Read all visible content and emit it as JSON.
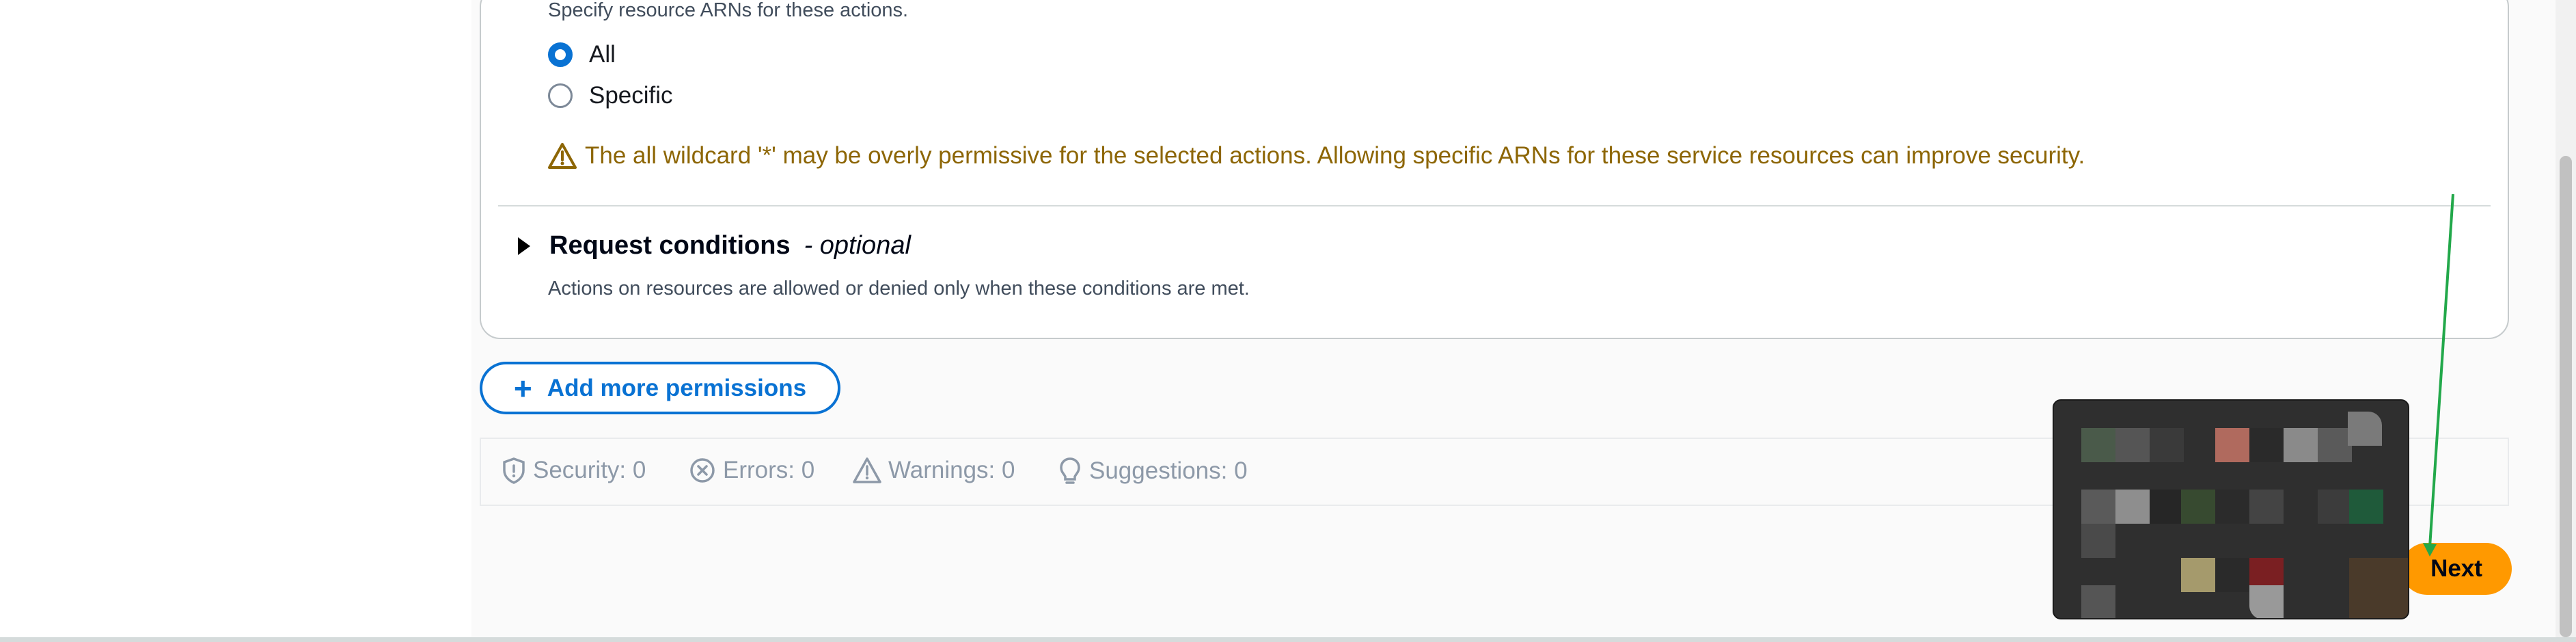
{
  "resources": {
    "description": "Specify resource ARNs for these actions.",
    "options": [
      {
        "label": "All",
        "selected": true
      },
      {
        "label": "Specific",
        "selected": false
      }
    ],
    "warning_text": "The all wildcard '*' may be overly permissive for the selected actions. Allowing specific ARNs for these service resources can improve security."
  },
  "request_conditions": {
    "title": "Request conditions",
    "optional_label": "- optional",
    "description": "Actions on resources are allowed or denied only when these conditions are met."
  },
  "add_permissions_button": "Add more permissions",
  "stats": {
    "security": "Security: 0",
    "errors": "Errors: 0",
    "warnings": "Warnings: 0",
    "suggestions": "Suggestions: 0"
  },
  "next_button": "Next",
  "colors": {
    "accent": "#0972d3",
    "warning": "#8d6605",
    "primary_button": "#ff9900",
    "annotation_arrow": "#22a84a"
  },
  "icons": [
    "warning-icon",
    "caret-right-icon",
    "plus-icon",
    "shield-icon",
    "error-circle-icon",
    "warning-triangle-icon",
    "lightbulb-icon"
  ]
}
